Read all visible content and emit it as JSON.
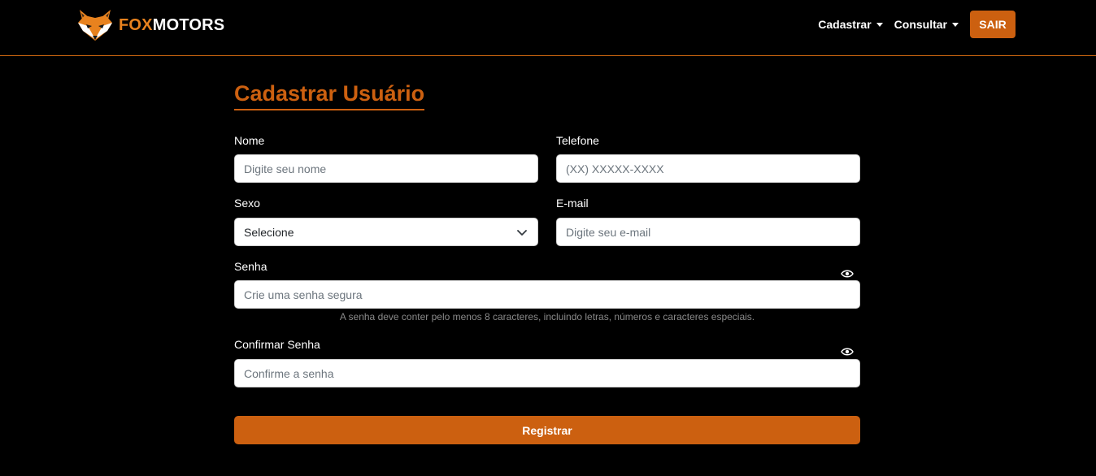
{
  "brand": {
    "icon": "fox-logo-icon",
    "name_part1": "FOX",
    "name_part2": "MOTORS",
    "accent_color": "#cc6010"
  },
  "nav": {
    "items": [
      {
        "label": "Cadastrar",
        "icon": "caret-down-icon"
      },
      {
        "label": "Consultar",
        "icon": "caret-down-icon"
      }
    ],
    "logout_label": "SAIR"
  },
  "form": {
    "title": "Cadastrar Usuário",
    "nome": {
      "label": "Nome",
      "placeholder": "Digite seu nome",
      "value": ""
    },
    "telefone": {
      "label": "Telefone",
      "placeholder": "(XX) XXXXX-XXXX",
      "value": ""
    },
    "sexo": {
      "label": "Sexo",
      "selected": "Selecione",
      "icon": "chevron-down-icon"
    },
    "email": {
      "label": "E-mail",
      "placeholder": "Digite seu e-mail",
      "value": ""
    },
    "senha": {
      "label": "Senha",
      "placeholder": "Crie uma senha segura",
      "value": "",
      "icon": "eye-icon",
      "hint": "A senha deve conter pelo menos 8 caracteres, incluindo letras, números e caracteres especiais."
    },
    "confirmar_senha": {
      "label": "Confirmar Senha",
      "placeholder": "Confirme a senha",
      "value": "",
      "icon": "eye-icon"
    },
    "submit_label": "Registrar"
  }
}
